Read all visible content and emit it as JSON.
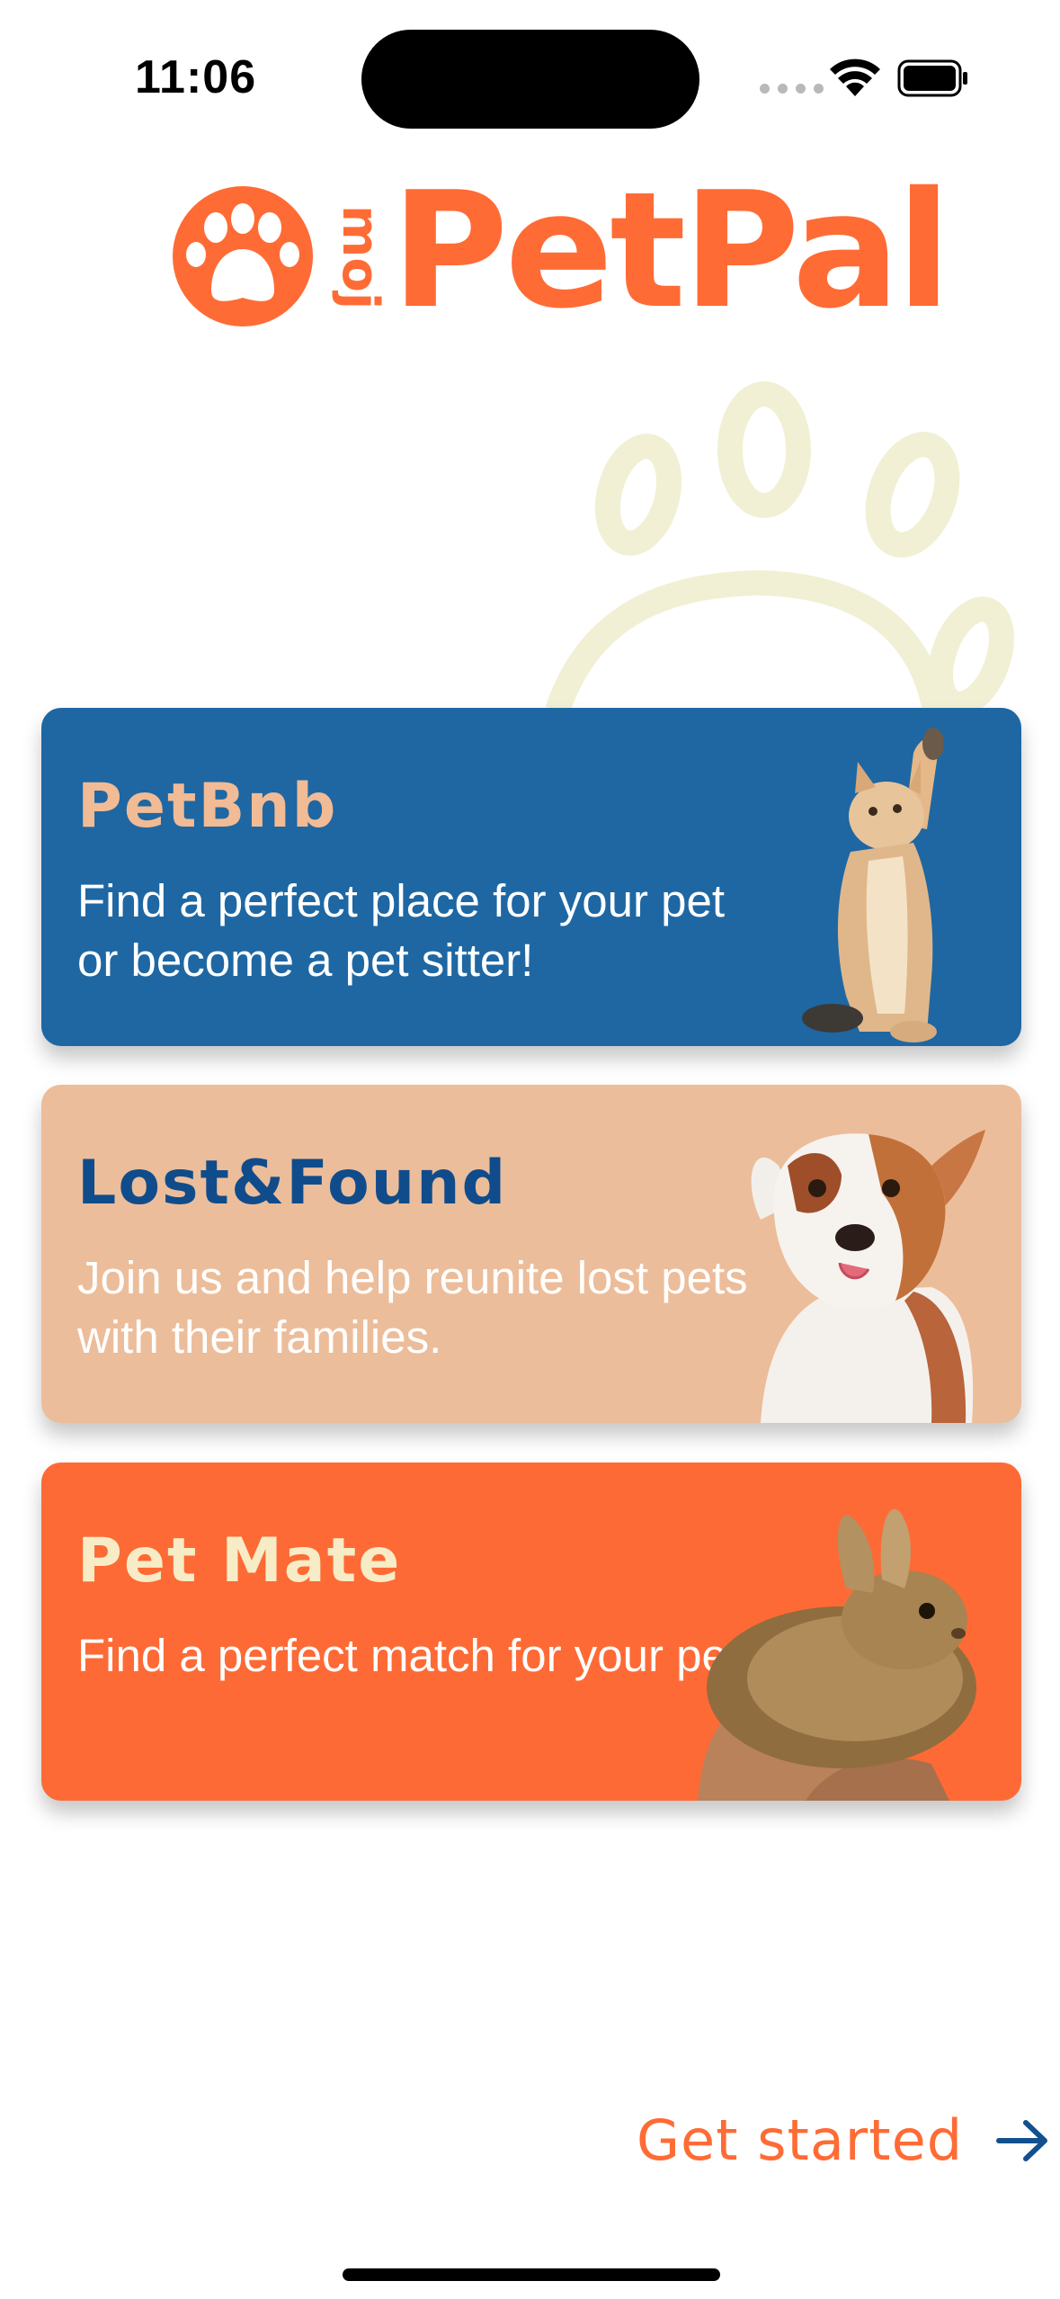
{
  "status_bar": {
    "time": "11:06"
  },
  "logo": {
    "prefix": "moj",
    "word": "PetPal",
    "color": "#ff6b35"
  },
  "cards": [
    {
      "title": "PetBnb",
      "text": "Find a perfect place for your pet or become a pet sitter!",
      "background": "#1e67a3",
      "title_color": "#f1bb95",
      "image": "cat-reaching-up"
    },
    {
      "title": "Lost&Found",
      "text": "Join us and help reunite lost pets with their families.",
      "background": "#ecbd9a",
      "title_color": "#104c8b",
      "image": "dog-licking-nose"
    },
    {
      "title": "Pet Mate",
      "text": "Find a perfect match for your pet!",
      "background": "#fe6a35",
      "title_color": "#f7ecc6",
      "image": "bunny-in-hands"
    }
  ],
  "footer": {
    "get_started_label": "Get started",
    "arrow_icon": "arrow-right-icon"
  }
}
